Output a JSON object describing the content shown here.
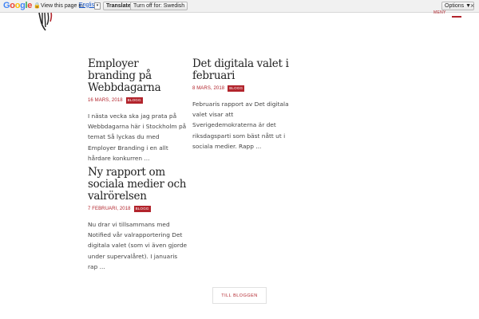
{
  "translate_bar": {
    "logo": "Google",
    "prefix": "View this page in:",
    "language": "English",
    "translate_label": "Translate",
    "turn_off_label": "Turn off for: Swedish",
    "options_label": "Options ▼",
    "close_label": "×"
  },
  "header": {
    "menu_label": "MENY"
  },
  "posts": [
    {
      "title": "Employer branding på Webbdagarna",
      "date": "16 MARS, 2018",
      "tag": "BLOGG",
      "excerpt": "I nästa vecka ska jag prata på Webbdagarna här i Stockholm på temat Så lyckas du med Employer Branding i en allt hårdare konkurren ..."
    },
    {
      "title": "Det digitala valet i februari",
      "date": "8 MARS, 2018",
      "tag": "BLOGG",
      "excerpt": "Februaris rapport av Det digitala valet visar att Sverigedemokraterna är det riksdagsparti som bäst nått ut i sociala medier. Rapp ..."
    },
    {
      "title": "Ny rapport om sociala medier och valrörelsen",
      "date": "7 FEBRUARI, 2018",
      "tag": "BLOGG",
      "excerpt": "Nu drar vi tillsammans med Notified vår valrapportering Det digitala valet (som vi även gjorde under supervalåret). I januaris rap ..."
    }
  ],
  "more_button": {
    "label": "TILL BLOGGEN"
  },
  "colors": {
    "accent": "#b2242c",
    "text": "#444444",
    "title": "#222222"
  }
}
